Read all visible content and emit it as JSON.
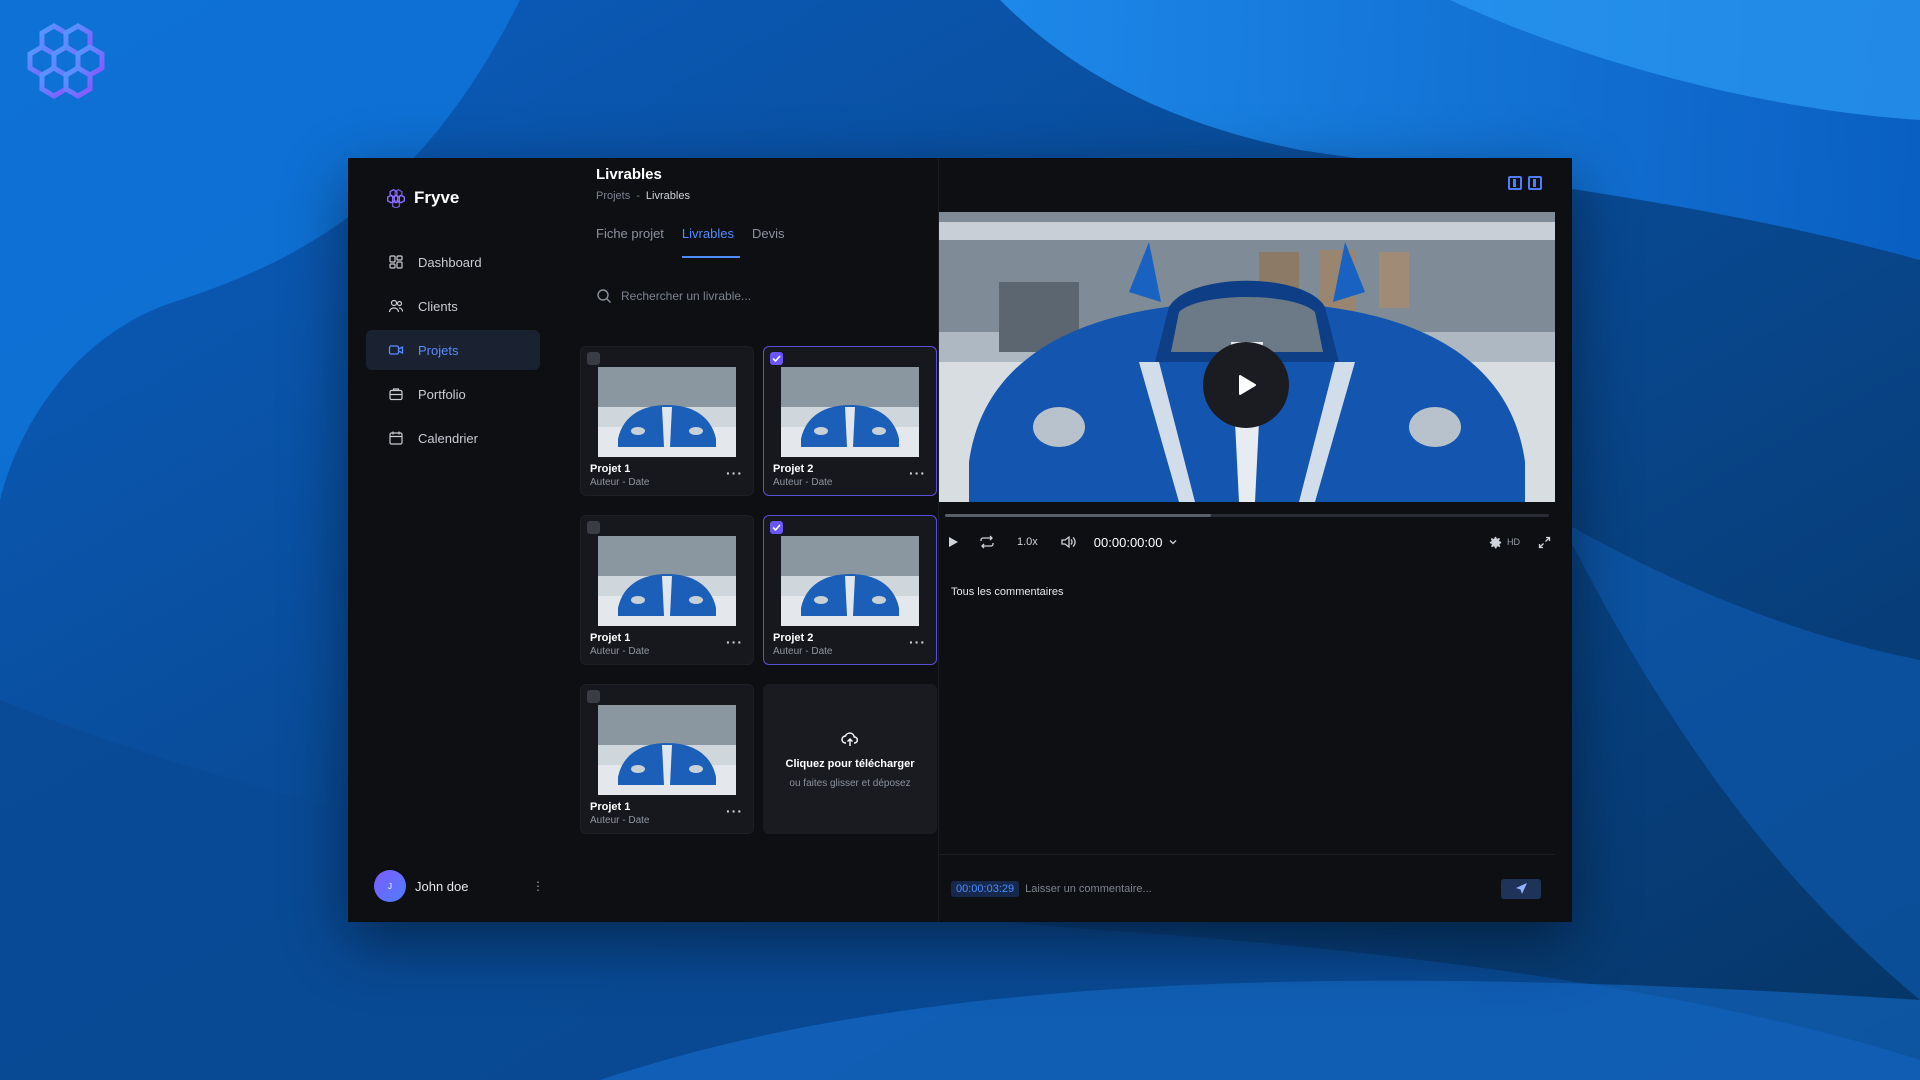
{
  "brand": {
    "name": "Fryve",
    "accent": "#7b5cff"
  },
  "sidebar": {
    "items": [
      {
        "label": "Dashboard",
        "icon": "dashboard-icon",
        "active": false
      },
      {
        "label": "Clients",
        "icon": "users-icon",
        "active": false
      },
      {
        "label": "Projets",
        "icon": "video-icon",
        "active": true
      },
      {
        "label": "Portfolio",
        "icon": "briefcase-icon",
        "active": false
      },
      {
        "label": "Calendrier",
        "icon": "calendar-icon",
        "active": false
      }
    ],
    "user": {
      "initial": "J",
      "name": "John doe"
    }
  },
  "header": {
    "title": "Livrables",
    "breadcrumb": [
      "Projets",
      "-",
      "Livrables"
    ]
  },
  "tabs": [
    {
      "label": "Fiche projet",
      "active": false
    },
    {
      "label": "Livrables",
      "active": true
    },
    {
      "label": "Devis",
      "active": false
    }
  ],
  "search": {
    "placeholder": "Rechercher un livrable..."
  },
  "cards": [
    {
      "title": "Projet 1",
      "subtitle": "Auteur - Date",
      "selected": false
    },
    {
      "title": "Projet 2",
      "subtitle": "Auteur - Date",
      "selected": true
    },
    {
      "title": "Projet 1",
      "subtitle": "Auteur - Date",
      "selected": false
    },
    {
      "title": "Projet 2",
      "subtitle": "Auteur - Date",
      "selected": true
    },
    {
      "title": "Projet 1",
      "subtitle": "Auteur - Date",
      "selected": false
    }
  ],
  "upload": {
    "title": "Cliquez pour télécharger",
    "subtitle": "ou faites glisser et déposez"
  },
  "player": {
    "speed": "1.0x",
    "time": "00:00:00:00",
    "quality": "HD",
    "progress": 0.44
  },
  "comments": {
    "heading": "Tous les commentaires",
    "timestamp": "00:00:03:29",
    "placeholder": "Laisser un commentaire..."
  }
}
